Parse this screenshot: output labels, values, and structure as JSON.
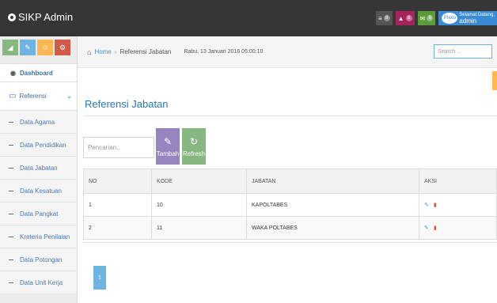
{
  "app": {
    "title": "SIKP Admin"
  },
  "navbar": {
    "badges": [
      {
        "icon": "tasks-icon",
        "count": "8"
      },
      {
        "icon": "bell-icon",
        "count": "8"
      },
      {
        "icon": "envelope-icon",
        "count": "8"
      }
    ],
    "user": {
      "photo_label": "Photo",
      "greeting": "Selamat Datang,",
      "name": "admin"
    }
  },
  "sidebar": {
    "shortcut_icons": [
      "signal-icon",
      "pencil-icon",
      "users-icon",
      "cogs-icon"
    ],
    "dashboard_label": "Dashboard",
    "referensi_label": "Referensi",
    "sub_items": [
      "Data Agama",
      "Data Pendidikan",
      "Data Jabatan",
      "Data Kesatuan",
      "Data Pangkat",
      "Kreteria Penilaian",
      "Data Potongan",
      "Data Unit Kerja"
    ]
  },
  "breadcrumb": {
    "home": "Home",
    "current": "Referensi Jabatan",
    "date": "Rabu, 13 Januari 2016 05:00:10"
  },
  "search": {
    "placeholder": "Search ..."
  },
  "main": {
    "title": "Referensi Jabatan",
    "filter_placeholder": "Pencarian..",
    "add_label": "Tambah",
    "refresh_label": "Refresh"
  },
  "table": {
    "headers": [
      "NO",
      "KODE",
      "JABATAN",
      "AKSI"
    ],
    "rows": [
      {
        "no": "1",
        "kode": "10",
        "jabatan": "KAPOLTABES"
      },
      {
        "no": "2",
        "kode": "11",
        "jabatan": "WAKA POLTABES"
      }
    ]
  },
  "pagination": {
    "current": "1"
  },
  "colors": {
    "accent": "#2679b5",
    "navbar": "#363636",
    "add": "#9585bf",
    "refresh": "#87b87f"
  }
}
